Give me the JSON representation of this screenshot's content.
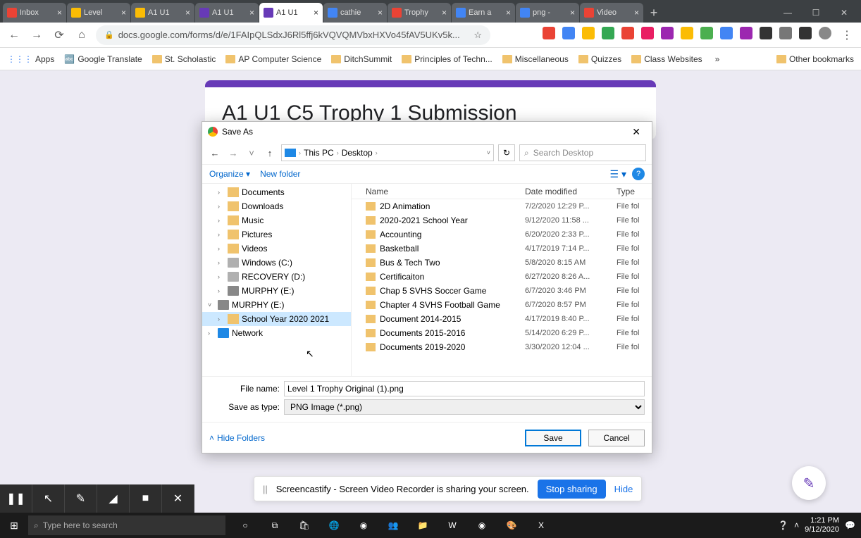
{
  "browser": {
    "tabs": [
      {
        "title": "Inbox",
        "favicon": "#ea4335"
      },
      {
        "title": "Level",
        "favicon": "#fbbc05"
      },
      {
        "title": "A1 U1",
        "favicon": "#fbbc05"
      },
      {
        "title": "A1 U1",
        "favicon": "#673ab7"
      },
      {
        "title": "A1 U1",
        "favicon": "#673ab7",
        "active": true
      },
      {
        "title": "cathie",
        "favicon": "#4285f4"
      },
      {
        "title": "Trophy",
        "favicon": "#ea4335"
      },
      {
        "title": "Earn a",
        "favicon": "#4285f4"
      },
      {
        "title": "png - ",
        "favicon": "#4285f4"
      },
      {
        "title": "Video",
        "favicon": "#ea4335"
      }
    ],
    "url": "docs.google.com/forms/d/e/1FAIpQLSdxJ6Rl5ffj6kVQVQMVbxHXVo45fAV5UKv5k...",
    "bookmarks": [
      {
        "label": "Apps",
        "type": "apps"
      },
      {
        "label": "Google Translate",
        "type": "link"
      },
      {
        "label": "St. Scholastic",
        "type": "folder"
      },
      {
        "label": "AP Computer Science",
        "type": "folder"
      },
      {
        "label": "DitchSummit",
        "type": "folder"
      },
      {
        "label": "Principles of Techn...",
        "type": "folder"
      },
      {
        "label": "Miscellaneous",
        "type": "folder"
      },
      {
        "label": "Quizzes",
        "type": "folder"
      },
      {
        "label": "Class Websites",
        "type": "folder"
      }
    ],
    "bookmark_overflow": "»",
    "other_bookmarks": "Other bookmarks"
  },
  "form": {
    "title": "A1 U1 C5 Trophy 1 Submission"
  },
  "dialog": {
    "title": "Save As",
    "breadcrumb": [
      "This PC",
      "Desktop"
    ],
    "search_placeholder": "Search Desktop",
    "organize": "Organize ▾",
    "new_folder": "New folder",
    "columns": {
      "name": "Name",
      "date": "Date modified",
      "type": "Type"
    },
    "tree": [
      {
        "label": "Documents",
        "indent": 1,
        "icon": "fold"
      },
      {
        "label": "Downloads",
        "indent": 1,
        "icon": "fold"
      },
      {
        "label": "Music",
        "indent": 1,
        "icon": "fold"
      },
      {
        "label": "Pictures",
        "indent": 1,
        "icon": "fold"
      },
      {
        "label": "Videos",
        "indent": 1,
        "icon": "fold"
      },
      {
        "label": "Windows (C:)",
        "indent": 1,
        "icon": "drive"
      },
      {
        "label": "RECOVERY (D:)",
        "indent": 1,
        "icon": "drive"
      },
      {
        "label": "MURPHY (E:)",
        "indent": 1,
        "icon": "usb"
      },
      {
        "label": "MURPHY (E:)",
        "indent": 0,
        "icon": "usb",
        "expanded": true
      },
      {
        "label": "School Year 2020 2021",
        "indent": 1,
        "icon": "fold",
        "selected": true
      },
      {
        "label": "Network",
        "indent": 0,
        "icon": "net"
      }
    ],
    "files": [
      {
        "name": "2D Animation",
        "date": "7/2/2020 12:29 P...",
        "type": "File fol"
      },
      {
        "name": "2020-2021 School Year",
        "date": "9/12/2020 11:58 ...",
        "type": "File fol"
      },
      {
        "name": "Accounting",
        "date": "6/20/2020 2:33 P...",
        "type": "File fol"
      },
      {
        "name": "Basketball",
        "date": "4/17/2019 7:14 P...",
        "type": "File fol"
      },
      {
        "name": "Bus & Tech Two",
        "date": "5/8/2020 8:15 AM",
        "type": "File fol"
      },
      {
        "name": "Certificaiton",
        "date": "6/27/2020 8:26 A...",
        "type": "File fol"
      },
      {
        "name": "Chap 5 SVHS Soccer Game",
        "date": "6/7/2020 3:46 PM",
        "type": "File fol"
      },
      {
        "name": "Chapter 4 SVHS Football Game",
        "date": "6/7/2020 8:57 PM",
        "type": "File fol"
      },
      {
        "name": "Document 2014-2015",
        "date": "4/17/2019 8:40 P...",
        "type": "File fol"
      },
      {
        "name": "Documents 2015-2016",
        "date": "5/14/2020 6:29 P...",
        "type": "File fol"
      },
      {
        "name": "Documents 2019-2020",
        "date": "3/30/2020 12:04 ...",
        "type": "File fol"
      }
    ],
    "filename_label": "File name:",
    "filename_value": "Level 1 Trophy Original (1).png",
    "savetype_label": "Save as type:",
    "savetype_value": "PNG Image (*.png)",
    "hide_folders": "Hide Folders",
    "save": "Save",
    "cancel": "Cancel"
  },
  "screencast": {
    "msg": "Screencastify - Screen Video Recorder is sharing your screen.",
    "stop": "Stop sharing",
    "hide": "Hide"
  },
  "taskbar": {
    "search_placeholder": "Type here to search",
    "time": "1:21 PM",
    "date": "9/12/2020"
  }
}
